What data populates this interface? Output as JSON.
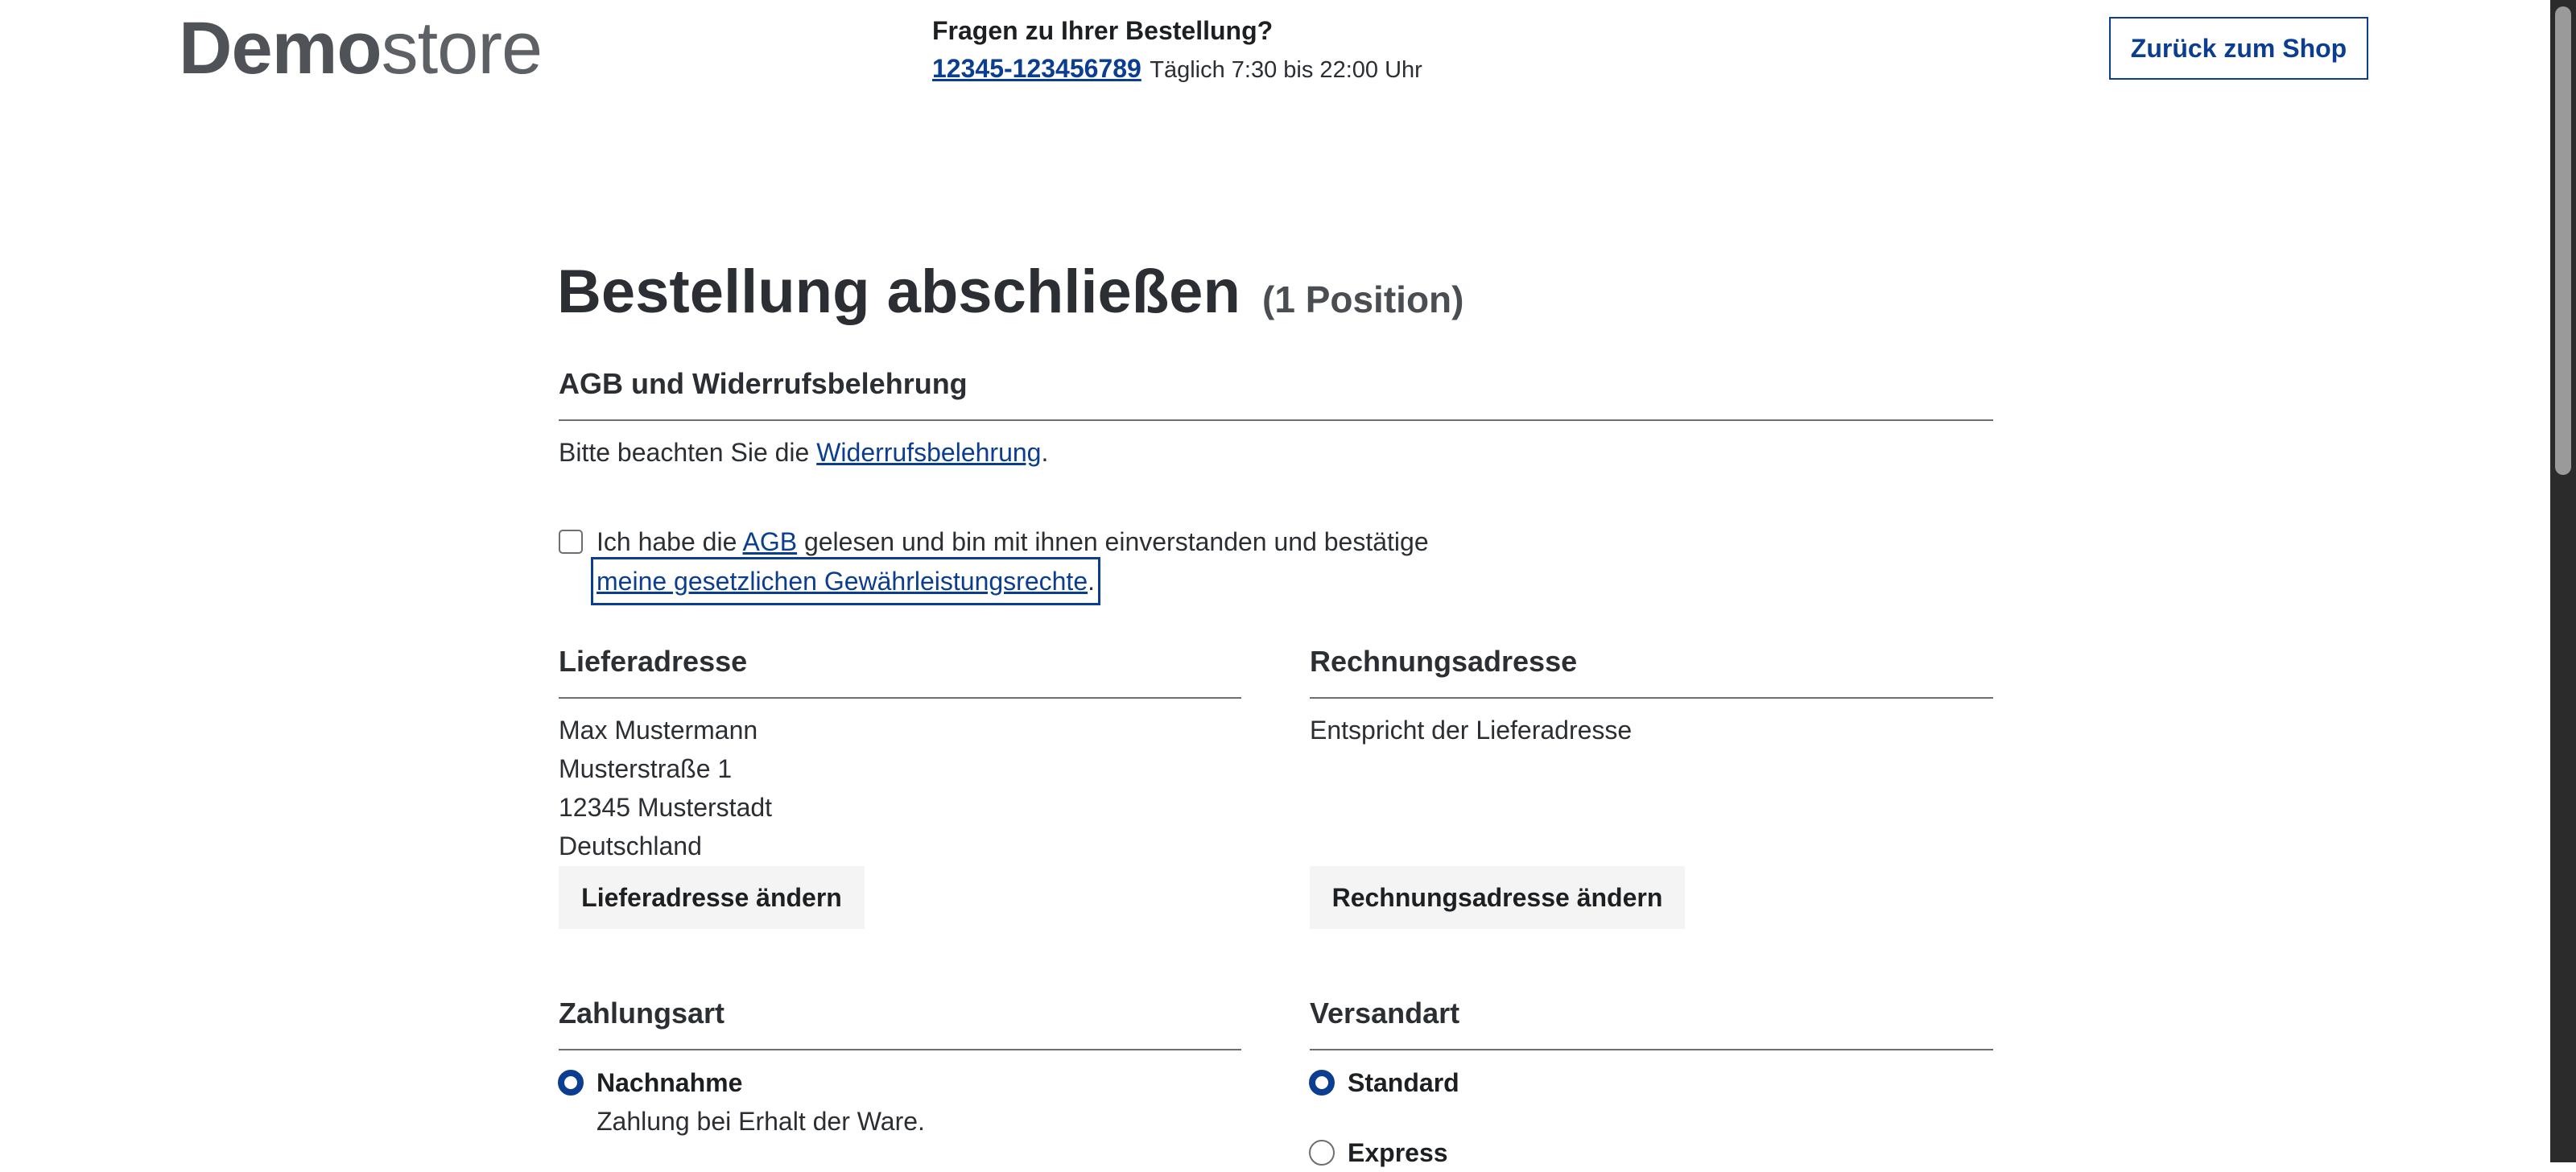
{
  "header": {
    "logo_bold": "Demo",
    "logo_light": "store",
    "contact_title": "Fragen zu Ihrer Bestellung?",
    "phone": "12345-123456789",
    "hours": "Täglich 7:30 bis 22:00 Uhr",
    "back_label": "Zurück zum Shop"
  },
  "main": {
    "title": "Bestellung abschließen",
    "position_count": "(1 Position)",
    "terms": {
      "heading": "AGB und Widerrufsbelehrung",
      "note_prefix": "Bitte beachten Sie die",
      "note_link": "Widerrufsbelehrung",
      "note_suffix": ".",
      "accept_prefix": "Ich habe die",
      "accept_link_agb": "AGB",
      "accept_middle": "gelesen und bin mit ihnen einverstanden und bestätige",
      "accept_link_rights": "meine gesetzlichen Gewährleistungsrechte",
      "accept_suffix": "."
    },
    "shipping_address": {
      "heading": "Lieferadresse",
      "lines": [
        "Max Mustermann",
        "Musterstraße 1",
        "12345 Musterstadt",
        "Deutschland"
      ],
      "change_label": "Lieferadresse ändern"
    },
    "billing_address": {
      "heading": "Rechnungsadresse",
      "text": "Entspricht der Lieferadresse",
      "change_label": "Rechnungsadresse ändern"
    },
    "payment": {
      "heading": "Zahlungsart",
      "option": "Nachnahme",
      "description": "Zahlung bei Erhalt der Ware."
    },
    "shipping_method": {
      "heading": "Versandart",
      "options": [
        "Standard",
        "Express"
      ]
    }
  },
  "colors": {
    "accent": "#0b3d91",
    "text": "#2b2f33",
    "button_bg": "#f4f4f4"
  }
}
